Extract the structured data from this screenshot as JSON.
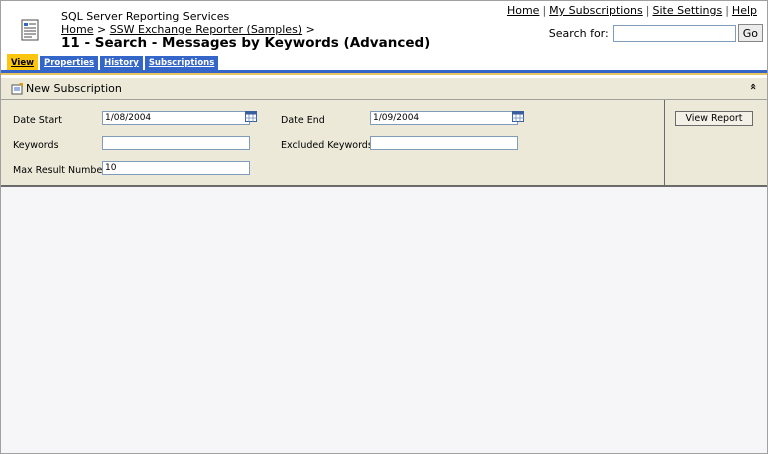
{
  "header": {
    "app_name": "SQL Server Reporting Services",
    "breadcrumb_home": "Home",
    "breadcrumb_sep1": ">",
    "breadcrumb_folder": "SSW Exchange Reporter (Samples)",
    "breadcrumb_sep2": ">",
    "page_title": "11 - Search - Messages by Keywords (Advanced)"
  },
  "top_links": {
    "home": "Home",
    "my_subscriptions": "My Subscriptions",
    "site_settings": "Site Settings",
    "help": "Help",
    "separator": "|"
  },
  "search": {
    "label": "Search for:",
    "value": "",
    "go_label": "Go"
  },
  "tabs": [
    {
      "label": "View",
      "active": true
    },
    {
      "label": "Properties",
      "active": false
    },
    {
      "label": "History",
      "active": false
    },
    {
      "label": "Subscriptions",
      "active": false
    }
  ],
  "toolbar": {
    "new_subscription": "New Subscription",
    "collapse_glyph": "«"
  },
  "params": {
    "date_start_label": "Date Start",
    "date_start_value": "1/08/2004",
    "date_end_label": "Date End",
    "date_end_value": "1/09/2004",
    "keywords_label": "Keywords",
    "keywords_value": "",
    "excluded_keywords_label": "Excluded Keywords",
    "excluded_keywords_value": "",
    "max_result_label": "Max Result Number",
    "max_result_value": "10",
    "view_report_label": "View Report"
  },
  "colors": {
    "tab_blue": "#3465c8",
    "tab_active": "#fcc50e",
    "panel_bg": "#ece9d8"
  }
}
